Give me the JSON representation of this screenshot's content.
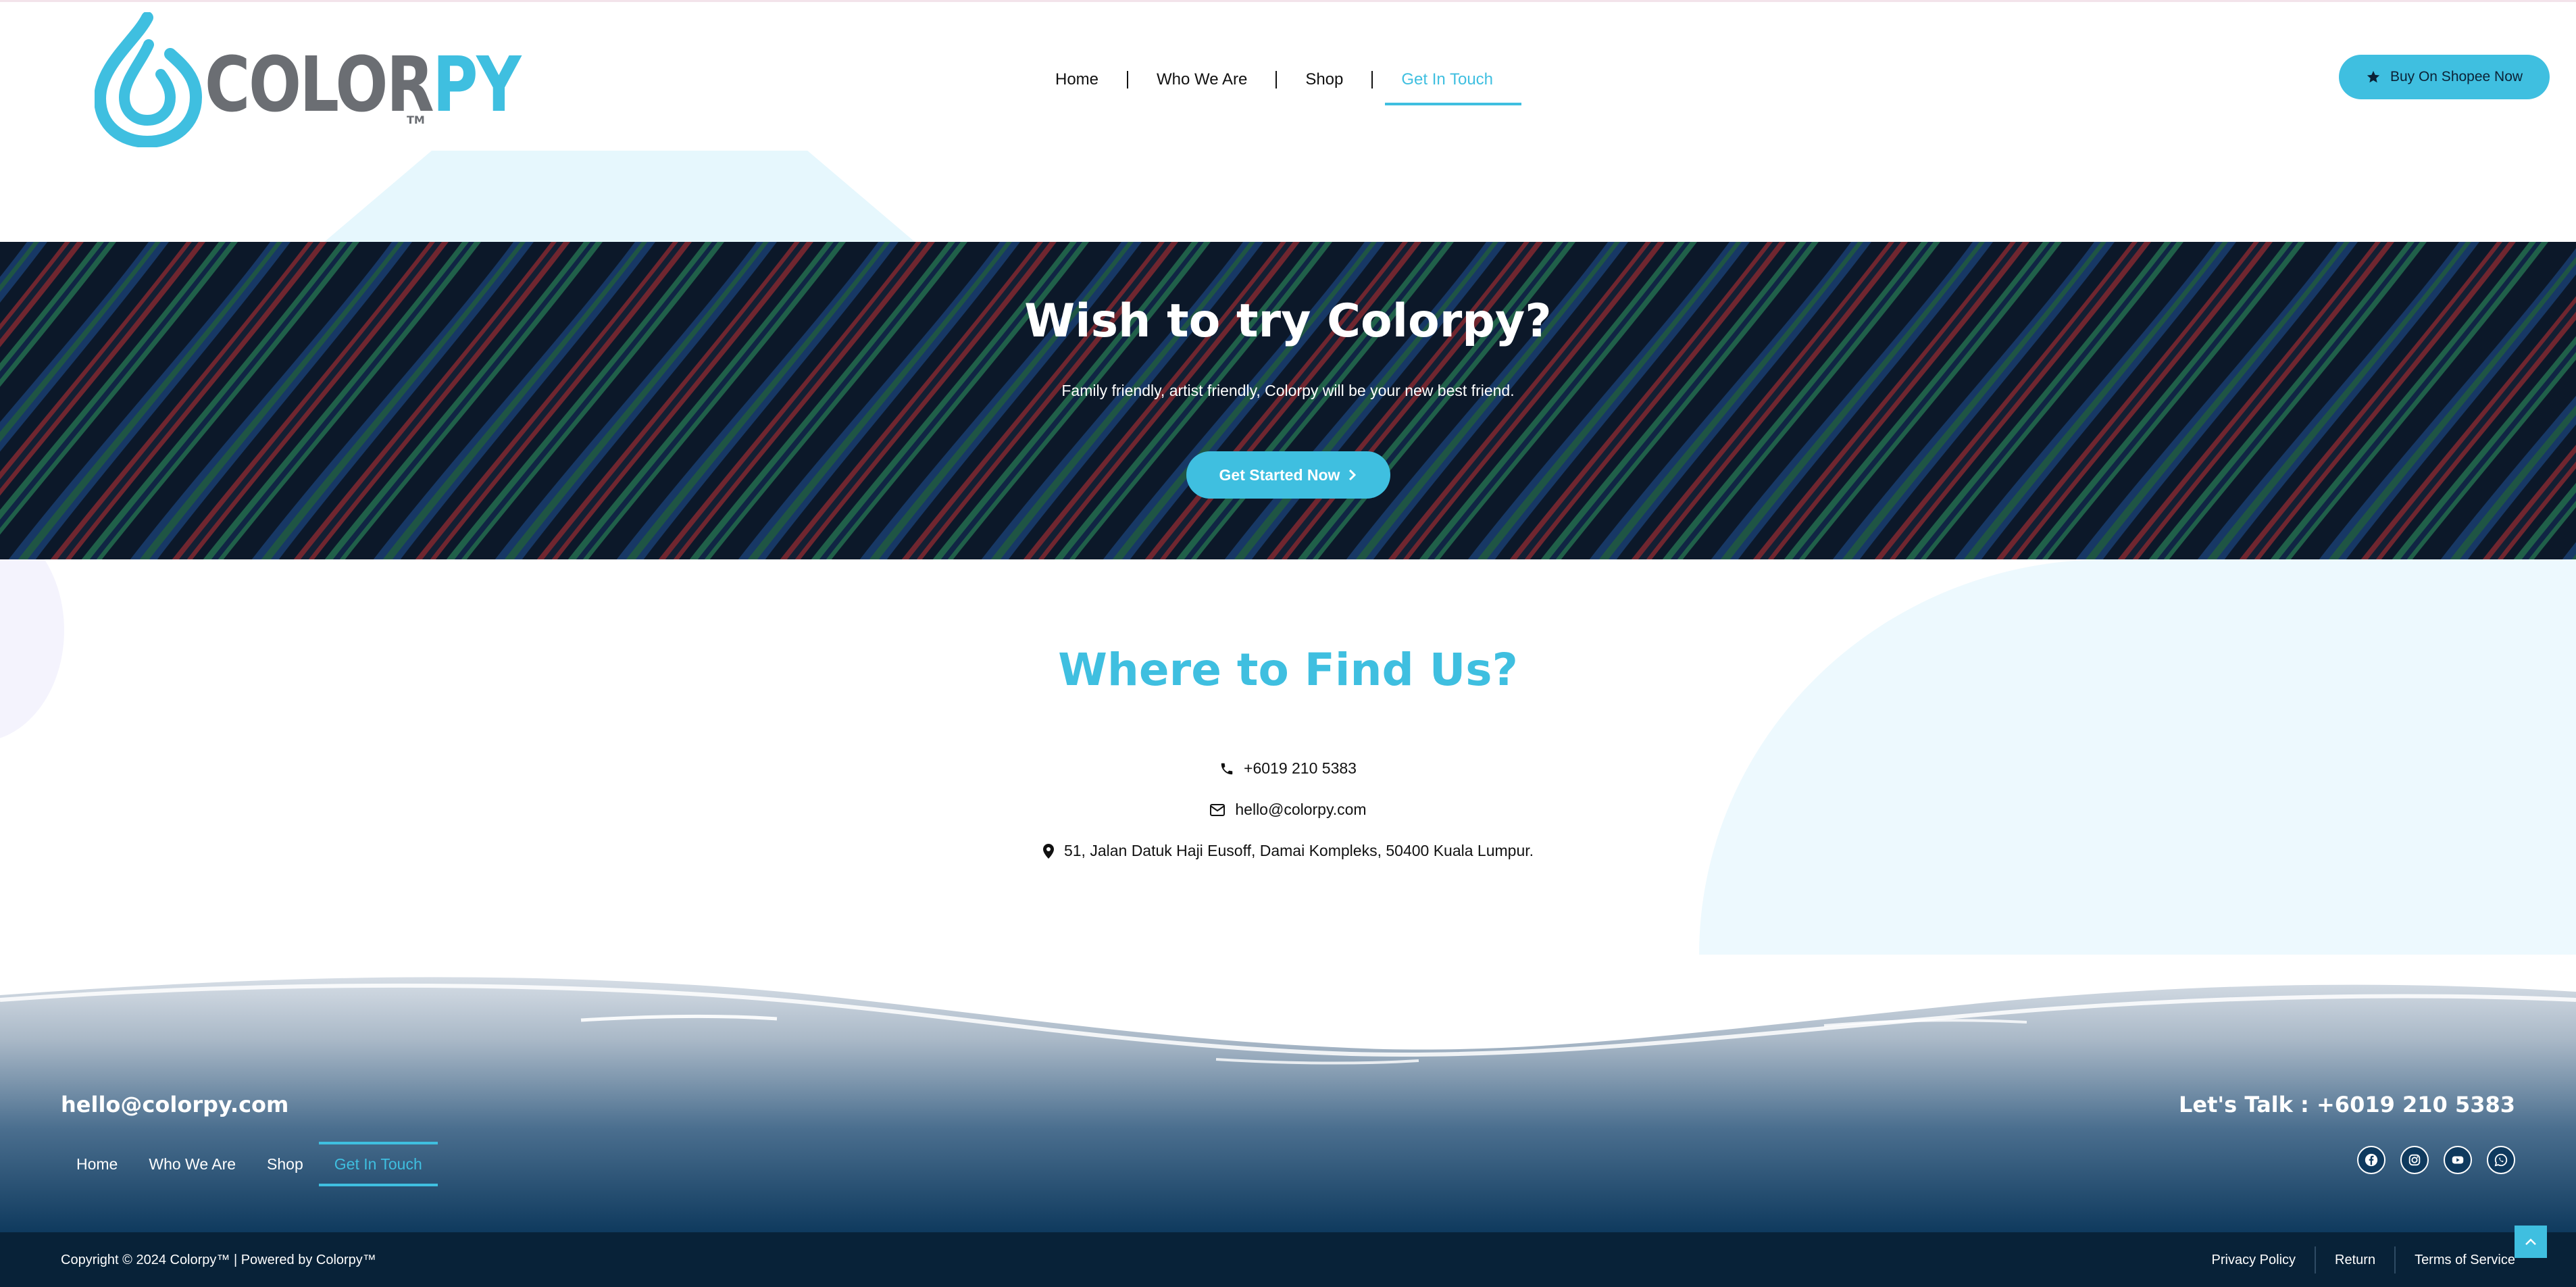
{
  "brand": {
    "name_part1": "COLOR",
    "name_part2": "PY",
    "trademark": "TM",
    "accent_color": "#3fbfe0",
    "gray_color": "#6b6e73"
  },
  "nav": {
    "items": [
      {
        "label": "Home",
        "active": false
      },
      {
        "label": "Who We Are",
        "active": false
      },
      {
        "label": "Shop",
        "active": false
      },
      {
        "label": "Get In Touch",
        "active": true
      }
    ],
    "cta_label": "Buy On Shopee Now",
    "cta_icon": "star-icon"
  },
  "hero": {
    "title": "Wish to try Colorpy?",
    "subtitle": "Family friendly, artist friendly, Colorpy will be your new best friend.",
    "button_label": "Get  Started  Now",
    "button_icon": "chevron-right-icon"
  },
  "find_us": {
    "title": "Where to Find Us?",
    "phone": "+6019 210 5383",
    "email": "hello@colorpy.com",
    "address": "51, Jalan Datuk Haji Eusoff, Damai Kompleks, 50400 Kuala Lumpur."
  },
  "footer": {
    "email": "hello@colorpy.com",
    "talk": "Let's Talk : +6019 210 5383",
    "nav": [
      {
        "label": "Home",
        "active": false
      },
      {
        "label": "Who We Are",
        "active": false
      },
      {
        "label": "Shop",
        "active": false
      },
      {
        "label": "Get In Touch",
        "active": true
      }
    ],
    "socials": [
      "facebook-icon",
      "instagram-icon",
      "youtube-icon",
      "whatsapp-icon"
    ],
    "copyright": "Copyright © 2024 Colorpy™ | Powered by Colorpy™",
    "legal": [
      "Privacy Policy",
      "Return",
      "Terms of Service"
    ]
  }
}
